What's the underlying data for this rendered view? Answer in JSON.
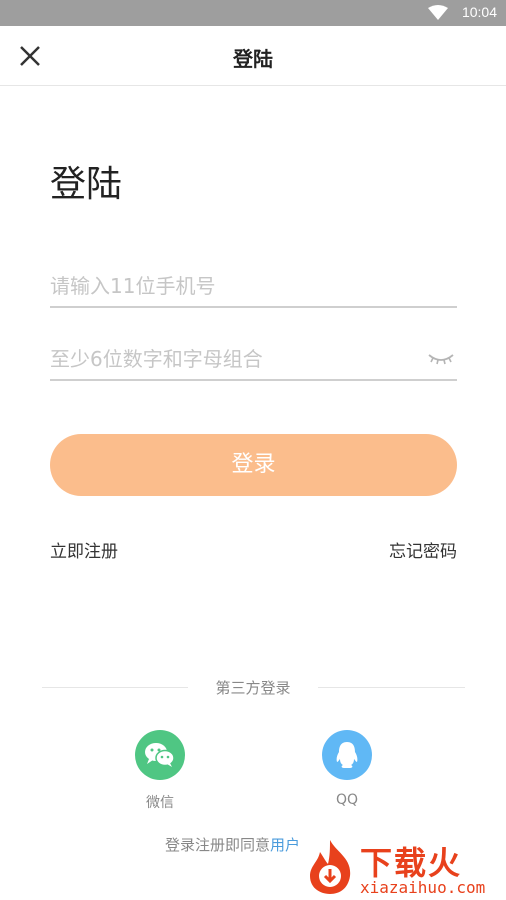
{
  "status_bar": {
    "time": "10:04"
  },
  "header": {
    "title": "登陆"
  },
  "page_heading": "登陆",
  "form": {
    "phone_placeholder": "请输入11位手机号",
    "password_placeholder": "至少6位数字和字母组合"
  },
  "login_button": "登录",
  "links": {
    "register": "立即注册",
    "forgot": "忘记密码"
  },
  "third_party": {
    "title": "第三方登录",
    "wechat": "微信",
    "qq": "QQ"
  },
  "agreement": {
    "prefix": "登录注册即同意",
    "link": "用户"
  },
  "watermark": {
    "name": "下载火",
    "url": "xiazaihuo.com"
  },
  "colors": {
    "status_bar": "#9e9e9e",
    "login_button": "#fbbd8c",
    "wechat": "#4fc683",
    "qq": "#60b8f5",
    "link": "#4a9bdc",
    "watermark": "#e8411c"
  }
}
